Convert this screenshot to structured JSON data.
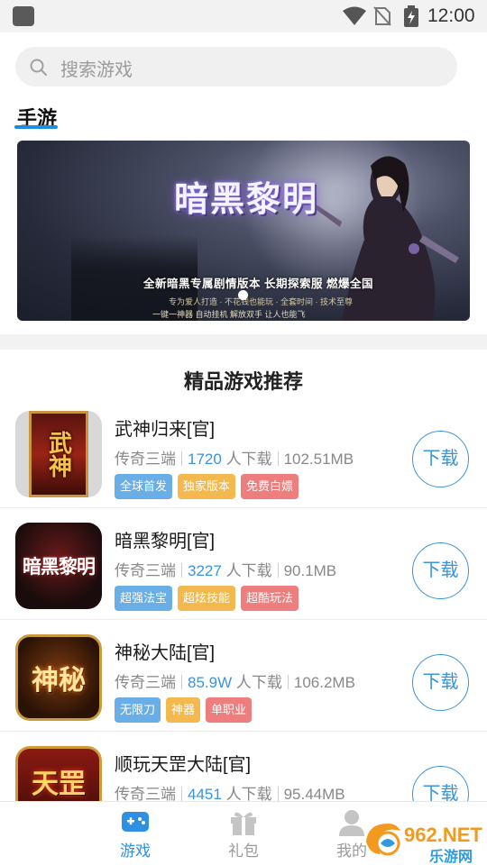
{
  "status_bar": {
    "time": "12:00"
  },
  "search": {
    "placeholder": "搜索游戏"
  },
  "section": {
    "title": "手游"
  },
  "banner": {
    "title": "暗黑黎明",
    "subtitle": "全新暗黑专属剧情版本 长期探索服 燃爆全国",
    "tagline1": "专为爱人打造 · 不花钱也能玩 · 全套时间 · 技术至尊",
    "tagline2": "一键一神器 自动挂机 解放双手 让人也能飞"
  },
  "recommend": {
    "title": "精品游戏推荐"
  },
  "games": [
    {
      "name": "武神归来[官]",
      "category": "传奇三端",
      "downloads": "1720",
      "downloads_suffix": "人下载",
      "size": "102.51MB",
      "tags": [
        "全球首发",
        "独家版本",
        "免费白嫖"
      ],
      "download_label": "下载",
      "icon_text": "武神"
    },
    {
      "name": "暗黑黎明[官]",
      "category": "传奇三端",
      "downloads": "3227",
      "downloads_suffix": "人下载",
      "size": "90.1MB",
      "tags": [
        "超强法宝",
        "超炫技能",
        "超酷玩法"
      ],
      "download_label": "下载",
      "icon_text": "暗黑黎明"
    },
    {
      "name": "神秘大陆[官]",
      "category": "传奇三端",
      "downloads": "85.9W",
      "downloads_suffix": "人下载",
      "size": "106.2MB",
      "tags": [
        "无限刀",
        "神器",
        "单职业"
      ],
      "download_label": "下载",
      "icon_text": "神秘"
    },
    {
      "name": "顺玩天罡大陆[官]",
      "category": "传奇三端",
      "downloads": "4451",
      "downloads_suffix": "人下载",
      "size": "95.44MB",
      "tags": [],
      "download_label": "下载",
      "icon_text": "天罡"
    }
  ],
  "bottom_nav": {
    "items": [
      {
        "label": "游戏",
        "icon": "gamepad-icon",
        "active": true
      },
      {
        "label": "礼包",
        "icon": "gift-icon",
        "active": false
      },
      {
        "label": "我的",
        "icon": "person-icon",
        "active": false
      }
    ]
  },
  "watermark": {
    "brand": "962.NET",
    "site": "乐游网"
  },
  "colors": {
    "accent": "#1d8fe0",
    "link": "#3a93dd",
    "tag_blue": "#69aee6",
    "tag_orange": "#f3b84e",
    "tag_red": "#ee7e7e"
  }
}
